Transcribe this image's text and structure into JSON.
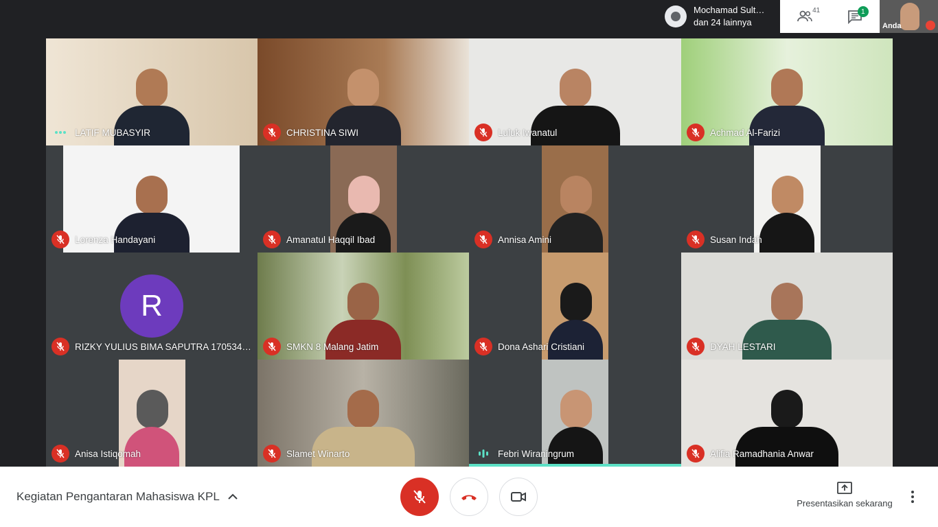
{
  "header": {
    "presenter_name": "Mochamad Sult…",
    "presenter_others": "dan 24 lainnya",
    "participants_count": "41",
    "chat_badge": "1",
    "self_label": "Anda"
  },
  "tiles": [
    {
      "name": "LATIF MUBASYIR",
      "status": "speaking-dots"
    },
    {
      "name": "CHRISTINA SIWI",
      "status": "muted"
    },
    {
      "name": "Luluk Iwanatul",
      "status": "muted"
    },
    {
      "name": "Achmad Al-Farizi",
      "status": "muted"
    },
    {
      "name": "Lorenza Handayani",
      "status": "muted"
    },
    {
      "name": "Amanatul Haqqil Ibad",
      "status": "muted"
    },
    {
      "name": "Annisa Amini",
      "status": "muted"
    },
    {
      "name": "Susan Indah",
      "status": "muted"
    },
    {
      "name": "RIZKY YULIUS BIMA SAPUTRA 1705346…",
      "status": "muted",
      "avatar": "R"
    },
    {
      "name": "SMKN 8 Malang Jatim",
      "status": "muted"
    },
    {
      "name": "Dona Ashari Cristiani",
      "status": "muted"
    },
    {
      "name": "DYAH LESTARI",
      "status": "muted"
    },
    {
      "name": "Anisa Istiqomah",
      "status": "muted"
    },
    {
      "name": "Slamet Winarto",
      "status": "muted"
    },
    {
      "name": "Febri Wiraningrum",
      "status": "speaking"
    },
    {
      "name": "Alifia Ramadhania Anwar",
      "status": "muted"
    }
  ],
  "footer": {
    "meeting_title": "Kegiatan Pengantaran Mahasiswa KPL",
    "present_label": "Presentasikan sekarang"
  },
  "colors": {
    "background": "#202124",
    "mute_red": "#d93025",
    "speaking_teal": "#5ce1c6",
    "avatar_purple": "#6d3bbd"
  }
}
